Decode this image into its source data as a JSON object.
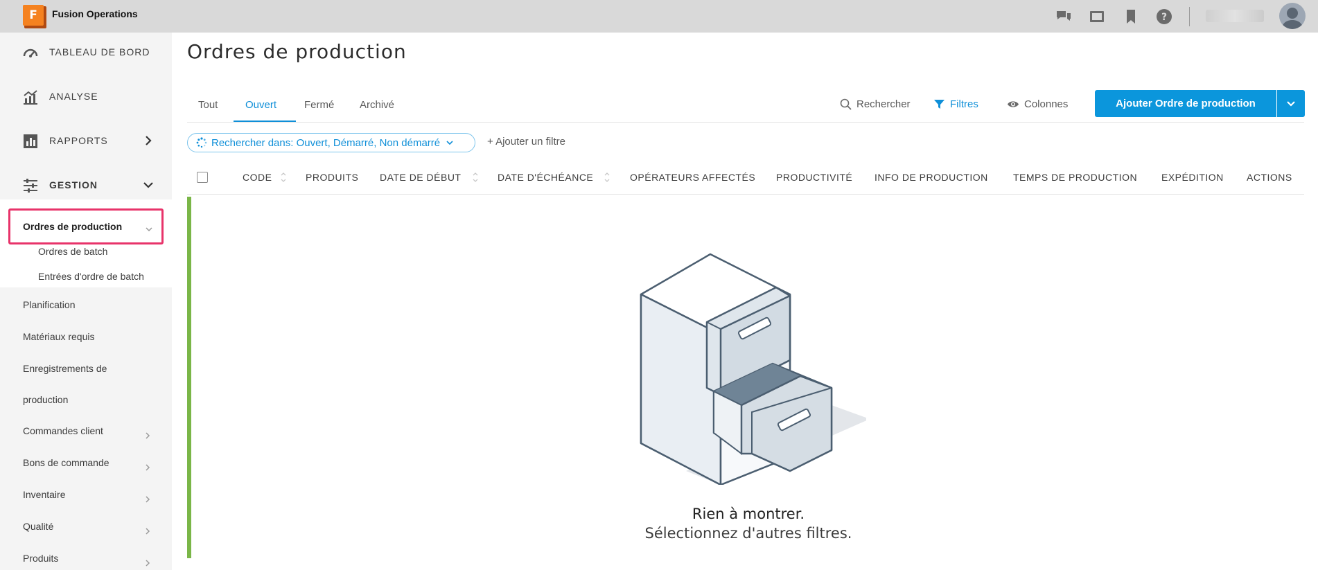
{
  "app": {
    "logo_letter": "F",
    "title": "Fusion Operations"
  },
  "topbar": {
    "icons": [
      "chat-icon",
      "presentation-icon",
      "bookmark-icon",
      "help-icon"
    ],
    "avatar": "user-avatar"
  },
  "sidebar": {
    "main": [
      {
        "label": "TABLEAU DE BORD",
        "icon": "dashboard-icon"
      },
      {
        "label": "ANALYSE",
        "icon": "analytics-icon"
      },
      {
        "label": "RAPPORTS",
        "icon": "reports-icon",
        "chevron": "right"
      },
      {
        "label": "GESTION",
        "icon": "management-icon",
        "chevron": "down"
      }
    ],
    "active": "Ordres de production",
    "sub": [
      "Ordres de batch",
      "Entrées d'ordre de batch"
    ],
    "items": [
      {
        "label": "Planification"
      },
      {
        "label": "Matériaux requis"
      },
      {
        "label": "Enregistrements de"
      },
      {
        "label": "production"
      },
      {
        "label": "Commandes client"
      },
      {
        "label": "Bons de commande"
      },
      {
        "label": "Inventaire"
      },
      {
        "label": "Qualité"
      },
      {
        "label": "Produits"
      }
    ]
  },
  "page": {
    "title": "Ordres de production"
  },
  "tabs": [
    "Tout",
    "Ouvert",
    "Fermé",
    "Archivé"
  ],
  "active_tab": "Ouvert",
  "toolbar": {
    "search": "Rechercher",
    "filters": "Filtres",
    "columns": "Colonnes",
    "add_button": "Ajouter Ordre de production"
  },
  "filter": {
    "chip": "Rechercher dans: Ouvert, Démarré, Non démarré",
    "add": "+ Ajouter un filtre"
  },
  "table": {
    "headers": [
      "CODE",
      "PRODUITS",
      "DATE DE DÉBUT",
      "DATE D'ÉCHÉANCE",
      "OPÉRATEURS AFFECTÉS",
      "PRODUCTIVITÉ",
      "INFO DE PRODUCTION",
      "TEMPS DE PRODUCTION",
      "EXPÉDITION",
      "ACTIONS"
    ]
  },
  "empty": {
    "title": "Rien à montrer.",
    "subtitle": "Sélectionnez d'autres filtres."
  },
  "colors": {
    "accent": "#0f8fd8",
    "button": "#0b96dc",
    "highlight": "#e8336a",
    "status_bar": "#7ab648",
    "logo": "#f58220"
  }
}
